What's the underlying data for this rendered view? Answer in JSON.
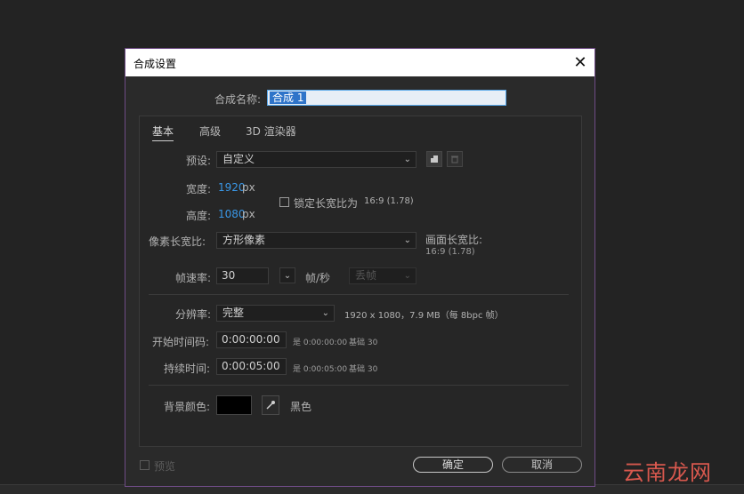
{
  "dialog": {
    "title": "合成设置",
    "close_glyph": "✕"
  },
  "comp_name": {
    "label": "合成名称:",
    "value": "合成 1"
  },
  "tabs": [
    {
      "label": "基本",
      "active": true
    },
    {
      "label": "高级",
      "active": false
    },
    {
      "label": "3D 渲染器",
      "active": false
    }
  ],
  "preset": {
    "label": "预设:",
    "value": "自定义"
  },
  "width": {
    "label": "宽度:",
    "value": "1920",
    "unit": "px"
  },
  "height": {
    "label": "高度:",
    "value": "1080",
    "unit": "px"
  },
  "lock_aspect": {
    "label": "锁定长宽比为",
    "ratio": "16:9 (1.78)",
    "checked": false
  },
  "pixel_aspect": {
    "label": "像素长宽比:",
    "value": "方形像素"
  },
  "frame_aspect": {
    "label": "画面长宽比:",
    "value": "16:9 (1.78)"
  },
  "frame_rate": {
    "label": "帧速率:",
    "value": "30",
    "unit": "帧/秒",
    "drop_frame": "丢帧"
  },
  "resolution": {
    "label": "分辨率:",
    "value": "完整",
    "info": "1920 x 1080，7.9 MB（每 8bpc 帧）"
  },
  "start_timecode": {
    "label": "开始时间码:",
    "value": "0:00:00:00",
    "eq": "是 0:00:00:00",
    "base": "基础 30"
  },
  "duration": {
    "label": "持续时间:",
    "value": "0:00:05:00",
    "eq": "是 0:00:05:00",
    "base": "基础 30"
  },
  "background": {
    "label": "背景颜色:",
    "color": "#000000",
    "name": "黑色"
  },
  "preview": {
    "label": "预览",
    "checked": false
  },
  "buttons": {
    "ok": "确定",
    "cancel": "取消"
  },
  "watermark": "云南龙网"
}
